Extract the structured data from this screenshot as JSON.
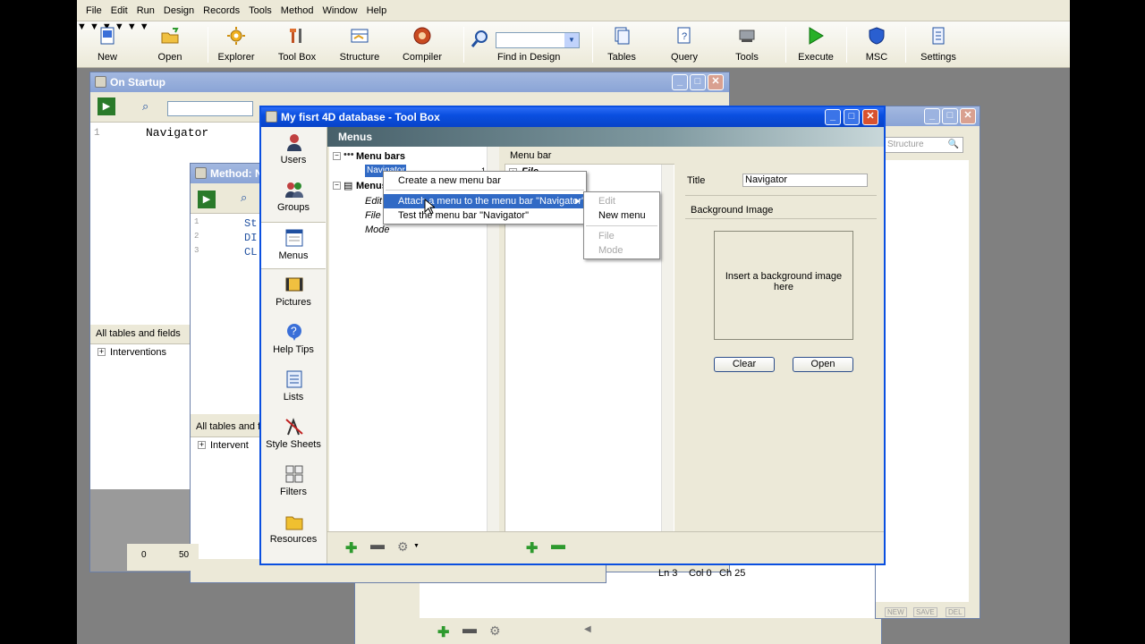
{
  "menubar": [
    "File",
    "Edit",
    "Run",
    "Design",
    "Records",
    "Tools",
    "Method",
    "Window",
    "Help"
  ],
  "toolbar": {
    "new": "New",
    "open": "Open",
    "explorer": "Explorer",
    "toolbox": "Tool Box",
    "structure": "Structure",
    "compiler": "Compiler",
    "find_in_design": "Find in Design",
    "tables": "Tables",
    "query": "Query",
    "tools": "Tools",
    "execute": "Execute",
    "msc": "MSC",
    "settings": "Settings"
  },
  "on_startup": {
    "title": "On Startup",
    "code_line": "Navigator",
    "line_number": "1",
    "tables_header": "All tables and fields",
    "tree_item": "Interventions"
  },
  "method_window": {
    "title": "Method: N",
    "lines": [
      "1",
      "2",
      "3"
    ],
    "code": [
      "St",
      "DI",
      "CL"
    ],
    "tables_header": "All tables and f",
    "tree_item": "Intervent",
    "ruler": [
      "0",
      "50"
    ]
  },
  "toolbox": {
    "title": "My fisrt 4D database - Tool Box",
    "section_title": "Menus",
    "side_items": [
      "Users",
      "Groups",
      "Menus",
      "Pictures",
      "Help Tips",
      "Lists",
      "Style Sheets",
      "Filters",
      "Resources"
    ],
    "tree": {
      "menu_bars": "Menu bars",
      "navigator": "Navigator",
      "navigator_count": "1",
      "menus": "Menus",
      "menu_children": [
        "Edit",
        "File",
        "Mode"
      ]
    },
    "menu_bar_header": "Menu bar",
    "menu_bar_item": "File",
    "title_label": "Title",
    "title_value": "Navigator",
    "bg_label": "Background Image",
    "bg_placeholder": "Insert a background image here",
    "clear_btn": "Clear",
    "open_btn": "Open",
    "status": [
      "Ln 3",
      "Col 0",
      "Ch 25"
    ]
  },
  "context_menu": {
    "items": [
      "Create a new menu bar",
      "Attach a menu to the menu bar \"Navigator\"",
      "Test the menu bar \"Navigator\""
    ],
    "submenu": [
      "Edit",
      "New menu",
      "File",
      "Mode"
    ]
  },
  "right_window": {
    "search_placeholder": "Structure",
    "buttons": [
      "NEW",
      "SAVE",
      "DEL"
    ]
  }
}
